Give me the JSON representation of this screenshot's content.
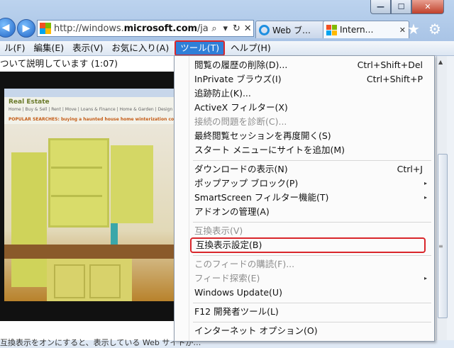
{
  "window": {
    "minimize_label": "—",
    "maximize_label": "☐",
    "close_label": "✕"
  },
  "nav": {
    "back_icon": "back-arrow-icon",
    "forward_icon": "forward-arrow-icon",
    "address_prefix": "http://windows.",
    "address_domain": "microsoft.com",
    "address_suffix": "/ja",
    "search_glyph": "⌕",
    "dropdown_glyph": "▾",
    "refresh_glyph": "↻",
    "stop_glyph": "✕"
  },
  "tabs": [
    {
      "label": "Web ブ…",
      "close": "✕"
    },
    {
      "label": "Intern…",
      "close": "✕"
    }
  ],
  "toolbar_icons": {
    "home": "★",
    "settings": "⚙"
  },
  "menubar": {
    "file": "ル(F)",
    "edit": "編集(E)",
    "view": "表示(V)",
    "favorites": "お気に入り(A)",
    "tools": "ツール(T)",
    "help": "ヘルプ(H)"
  },
  "page": {
    "caption_top": "ついて説明しています (1:07)",
    "caption_bottom": "互換表示をオンにすると、表示している Web サイトが…",
    "video": {
      "site_title": "Real Estate",
      "site_nav": "Home | Buy & Sell | Rent | Move | Loans & Finance | Home & Garden | Design Center",
      "popular": "POPULAR SEARCHES: buying a haunted house  home winterization  condo-buying"
    }
  },
  "tools_menu": {
    "items": [
      {
        "label": "閲覧の履歴の削除(D)...",
        "shortcut": "Ctrl+Shift+Del"
      },
      {
        "label": "InPrivate ブラウズ(I)",
        "shortcut": "Ctrl+Shift+P"
      },
      {
        "label": "追跡防止(K)..."
      },
      {
        "label": "ActiveX フィルター(X)"
      },
      {
        "label": "接続の問題を診断(C)..."
      },
      {
        "label": "最終閲覧セッションを再度開く(S)"
      },
      {
        "label": "スタート メニューにサイトを追加(M)"
      },
      {
        "label": "ダウンロードの表示(N)",
        "shortcut": "Ctrl+J"
      },
      {
        "label": "ポップアップ ブロック(P)"
      },
      {
        "label": "SmartScreen フィルター機能(T)"
      },
      {
        "label": "アドオンの管理(A)"
      },
      {
        "label": "互換表示(V)"
      },
      {
        "label": "互換表示設定(B)"
      },
      {
        "label": "このフィードの購読(F)..."
      },
      {
        "label": "フィード探索(E)"
      },
      {
        "label": "Windows Update(U)"
      },
      {
        "label": "F12 開発者ツール(L)"
      },
      {
        "label": "インターネット オプション(O)"
      }
    ],
    "submenu_arrow": "▸"
  },
  "colors": {
    "menu_highlight": "#2f7fd8",
    "annotation_red": "#d9262b"
  }
}
